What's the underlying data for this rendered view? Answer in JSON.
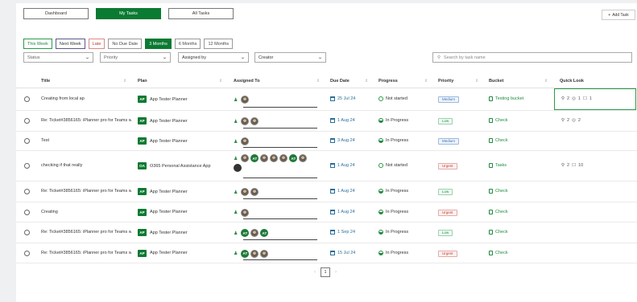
{
  "nav": {
    "dashboard": "Dashboard",
    "my_tasks": "My Tasks",
    "all_tasks": "All Tasks",
    "add_task": "Add Task"
  },
  "filters": {
    "chips": [
      "This Week",
      "Next Week",
      "Late",
      "No Due Date",
      "3 Months",
      "6 Months",
      "12 Months"
    ],
    "active_chip": "3 Months",
    "status": "Status",
    "priority": "Priority",
    "assigned_by": "Assigned by",
    "creator": "Creator",
    "search_placeholder": "Search by task name"
  },
  "columns": [
    "Title",
    "Plan",
    "Assigned To",
    "Due Date",
    "Progress",
    "Priority",
    "Bucket",
    "Quick Look"
  ],
  "rows": [
    {
      "title": "Creating from local ap",
      "plan_badge": "AP",
      "plan": "App Tester Planner",
      "avatars": [
        "photo"
      ],
      "due": "25 Jul 24",
      "progress": "Not started",
      "priority": "Medium",
      "bucket": "Testing bucket",
      "ql_attach": "2",
      "ql_check": "1",
      "ql_comment": "1"
    },
    {
      "title": "Re: Ticket#3856165: iPlanner pro for Teams w",
      "plan_badge": "AP",
      "plan": "App Tester Planner",
      "avatars": [
        "photo",
        "photo"
      ],
      "due": "1 Aug 24",
      "progress": "In Progress",
      "priority": "Low",
      "bucket": "Check",
      "ql_attach": "2",
      "ql_check": "2",
      "ql_comment": ""
    },
    {
      "title": "Test",
      "plan_badge": "AP",
      "plan": "App Tester Planner",
      "avatars": [
        "photo"
      ],
      "due": "3 Aug 24",
      "progress": "In Progress",
      "priority": "Medium",
      "bucket": "Check",
      "ql_attach": "",
      "ql_check": "",
      "ql_comment": ""
    },
    {
      "title": "checking if that really",
      "plan_badge": "OA",
      "plan": "O365 Personal Assistance App",
      "avatars": [
        "photo",
        "at",
        "photo",
        "photo",
        "photo",
        "at",
        "photo",
        "dark"
      ],
      "due": "1 Aug 24",
      "progress": "Not started",
      "priority": "Urgent",
      "bucket": "Tasks",
      "ql_attach": "2",
      "ql_check": "",
      "ql_comment": "10"
    },
    {
      "title": "Re: Ticket#3856165: iPlanner pro for Teams w",
      "plan_badge": "AP",
      "plan": "App Tester Planner",
      "avatars": [
        "photo",
        "photo"
      ],
      "due": "1 Aug 24",
      "progress": "In Progress",
      "priority": "Low",
      "bucket": "Check",
      "ql_attach": "",
      "ql_check": "",
      "ql_comment": ""
    },
    {
      "title": "Creating",
      "plan_badge": "AP",
      "plan": "App Tester Planner",
      "avatars": [
        "photo"
      ],
      "due": "1 Aug 24",
      "progress": "In Progress",
      "priority": "Urgent",
      "bucket": "Check",
      "ql_attach": "",
      "ql_check": "",
      "ql_comment": ""
    },
    {
      "title": "Re: Ticket#3856165: iPlanner pro for Teams w",
      "plan_badge": "AP",
      "plan": "App Tester Planner",
      "avatars": [
        "at",
        "photo",
        "at"
      ],
      "due": "1 Sep 24",
      "progress": "In Progress",
      "priority": "Low",
      "bucket": "Check",
      "ql_attach": "",
      "ql_check": "",
      "ql_comment": ""
    },
    {
      "title": "Re: Ticket#3856165: iPlanner pro for Teams w",
      "plan_badge": "AP",
      "plan": "App Tester Planner",
      "avatars": [
        "at",
        "photo",
        "photo"
      ],
      "due": "15 Jul 24",
      "progress": "In Progress",
      "priority": "Urgent",
      "bucket": "Check",
      "ql_attach": "",
      "ql_check": "",
      "ql_comment": ""
    }
  ],
  "avatar_initials": "AT",
  "pager": {
    "page": "1"
  }
}
